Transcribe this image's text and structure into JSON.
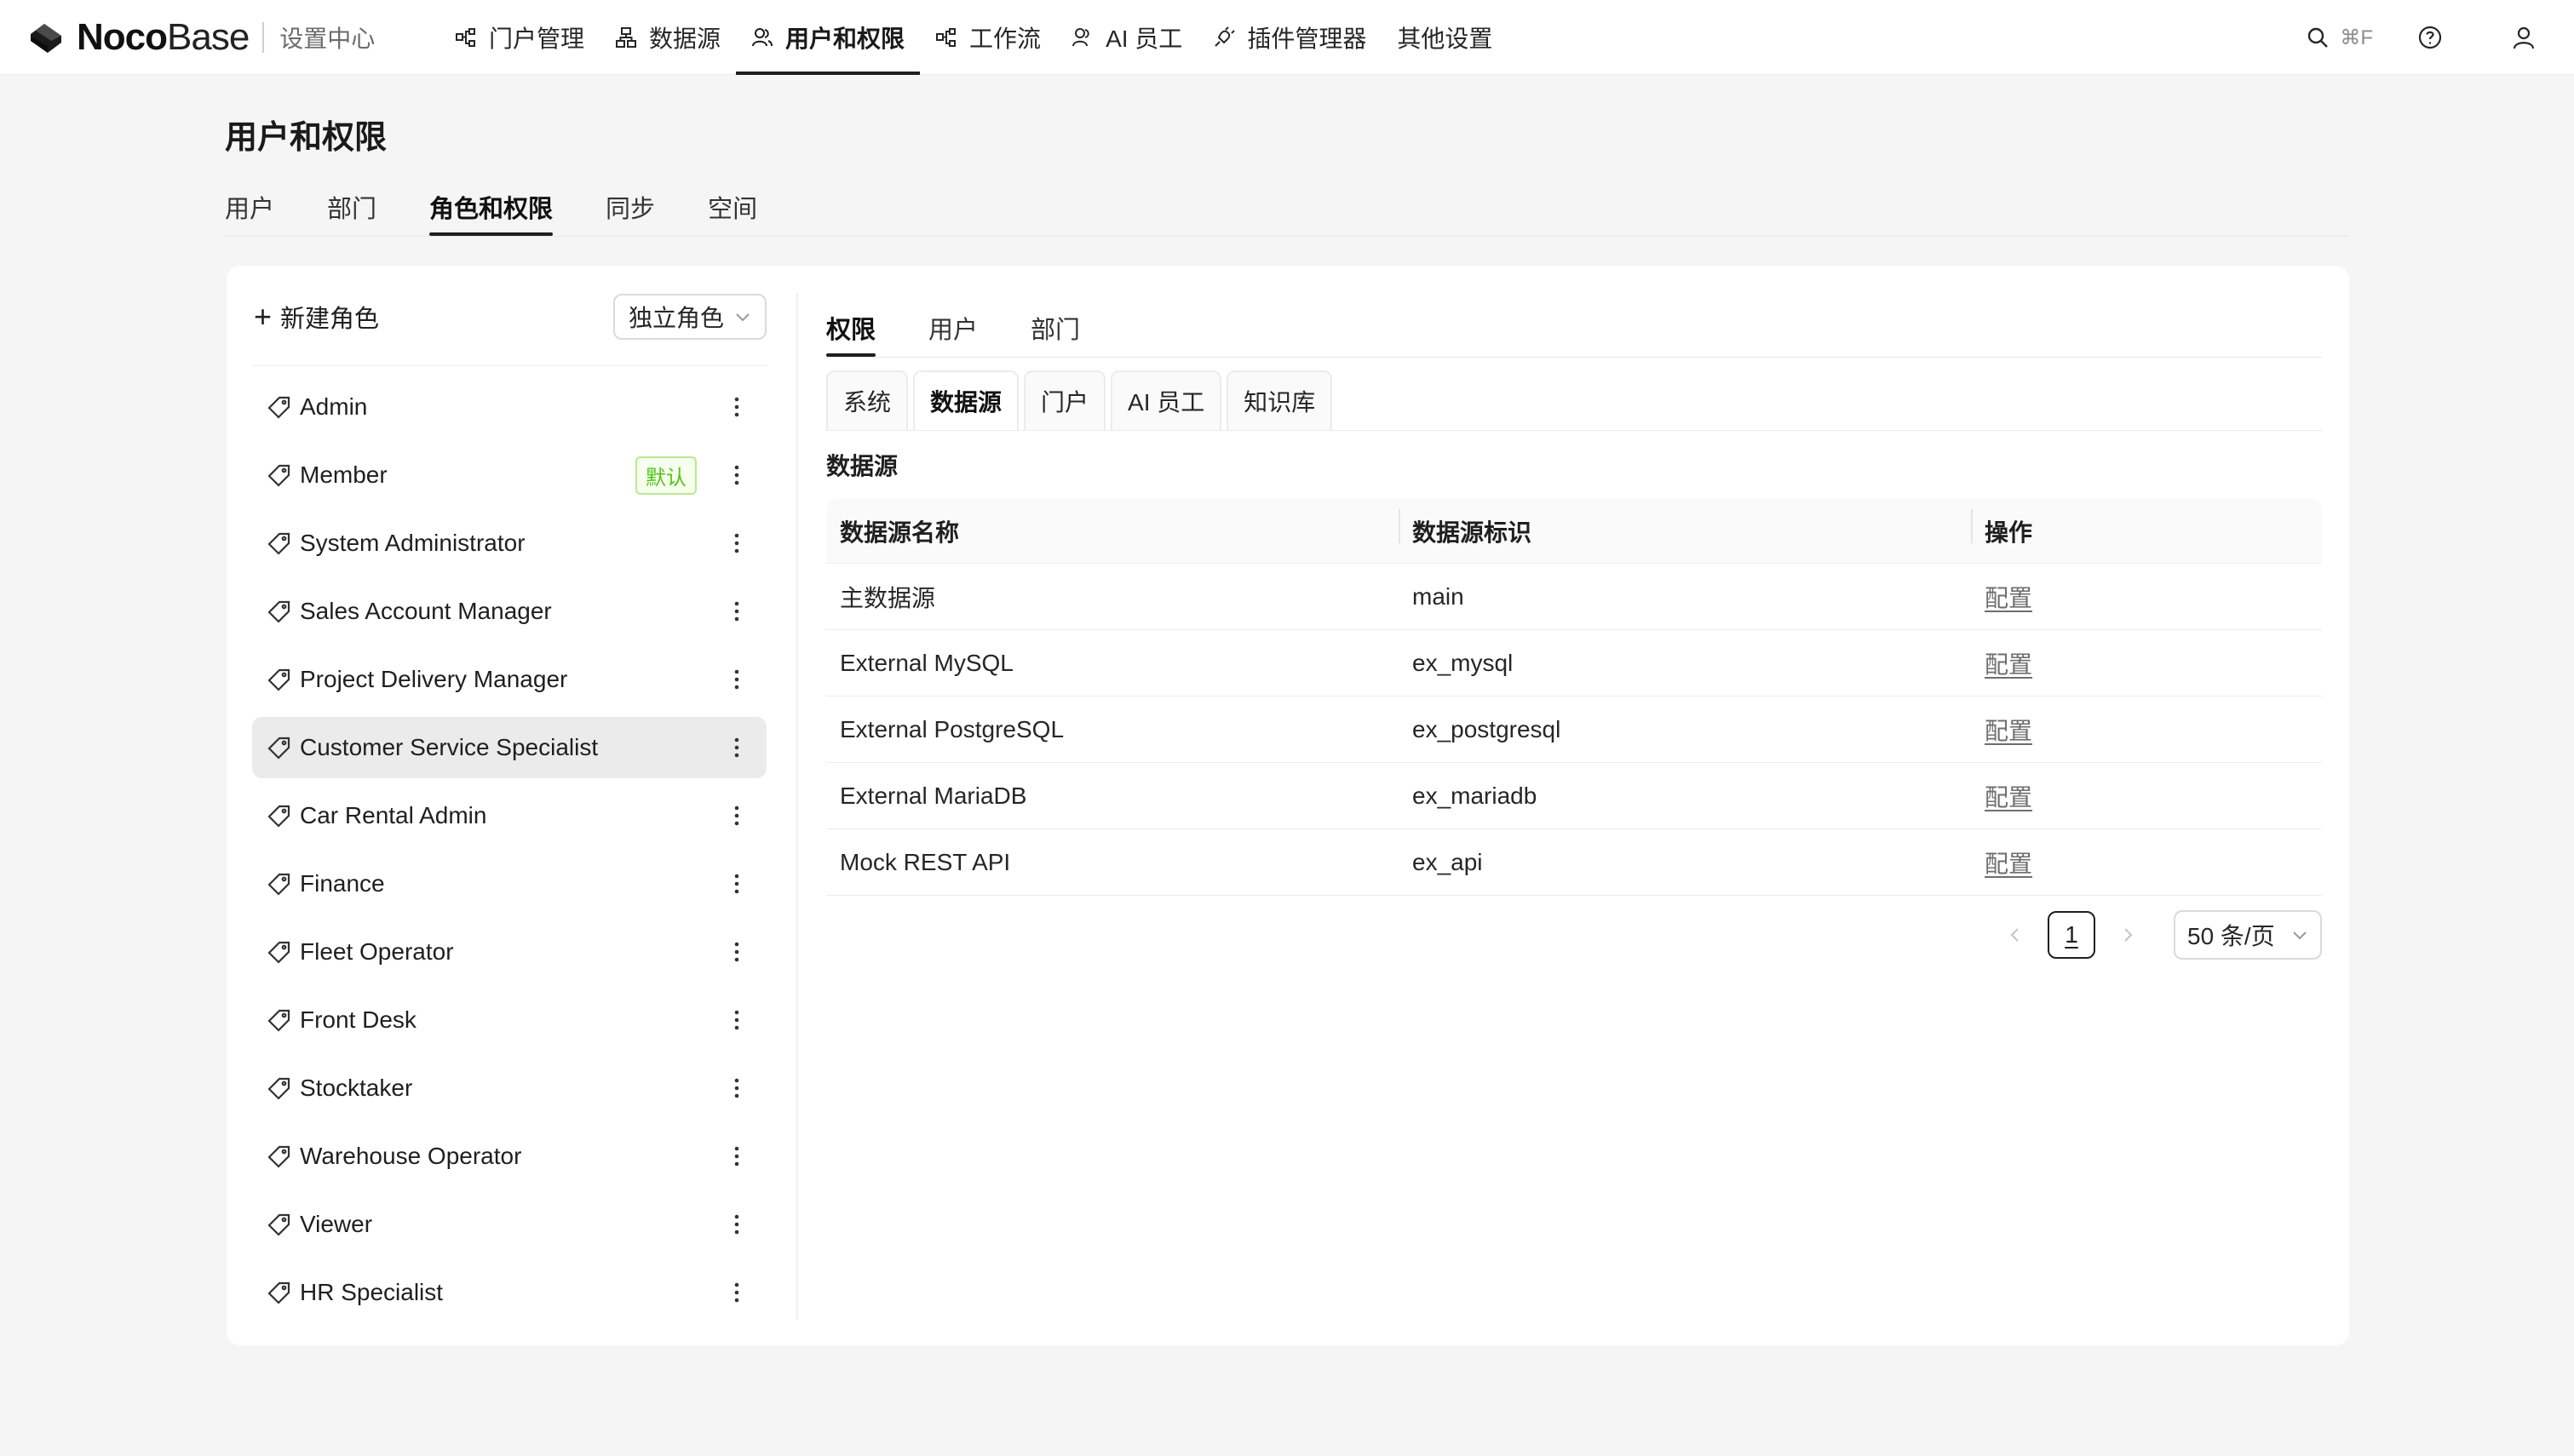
{
  "brand": {
    "name_bold": "Noco",
    "name_light": "Base",
    "subtitle": "设置中心"
  },
  "nav": {
    "items": [
      {
        "label": "门户管理",
        "icon": "portal-icon",
        "active": false
      },
      {
        "label": "数据源",
        "icon": "datasource-icon",
        "active": false
      },
      {
        "label": "用户和权限",
        "icon": "users-icon",
        "active": true
      },
      {
        "label": "工作流",
        "icon": "workflow-icon",
        "active": false
      },
      {
        "label": "AI 员工",
        "icon": "ai-employee-icon",
        "active": false
      },
      {
        "label": "插件管理器",
        "icon": "plugin-icon",
        "active": false
      },
      {
        "label": "其他设置",
        "icon": "",
        "active": false
      }
    ],
    "search_shortcut": "⌘F"
  },
  "page": {
    "title": "用户和权限",
    "tabs": [
      "用户",
      "部门",
      "角色和权限",
      "同步",
      "空间"
    ],
    "active_tab": "角色和权限"
  },
  "roles": {
    "new_label": "新建角色",
    "mode_select": "独立角色",
    "default_badge": "默认",
    "items": [
      "Admin",
      "Member",
      "System Administrator",
      "Sales Account Manager",
      "Project Delivery Manager",
      "Customer Service Specialist",
      "Car Rental Admin",
      "Finance",
      "Fleet Operator",
      "Front Desk",
      "Stocktaker",
      "Warehouse Operator",
      "Viewer",
      "HR Specialist"
    ],
    "selected": "Customer Service Specialist",
    "default_role": "Member"
  },
  "perm": {
    "tabs": [
      "权限",
      "用户",
      "部门"
    ],
    "active_tab": "权限",
    "sub_tabs": [
      "系统",
      "数据源",
      "门户",
      "AI 员工",
      "知识库"
    ],
    "active_sub_tab": "数据源",
    "section_label": "数据源",
    "table": {
      "columns": [
        "数据源名称",
        "数据源标识",
        "操作"
      ],
      "rows": [
        {
          "name": "主数据源",
          "key": "main",
          "action": "配置"
        },
        {
          "name": "External MySQL",
          "key": "ex_mysql",
          "action": "配置"
        },
        {
          "name": "External PostgreSQL",
          "key": "ex_postgresql",
          "action": "配置"
        },
        {
          "name": "External MariaDB",
          "key": "ex_mariadb",
          "action": "配置"
        },
        {
          "name": "Mock REST API",
          "key": "ex_api",
          "action": "配置"
        }
      ]
    },
    "pagination": {
      "current_page": "1",
      "page_size": "50 条/页"
    }
  }
}
